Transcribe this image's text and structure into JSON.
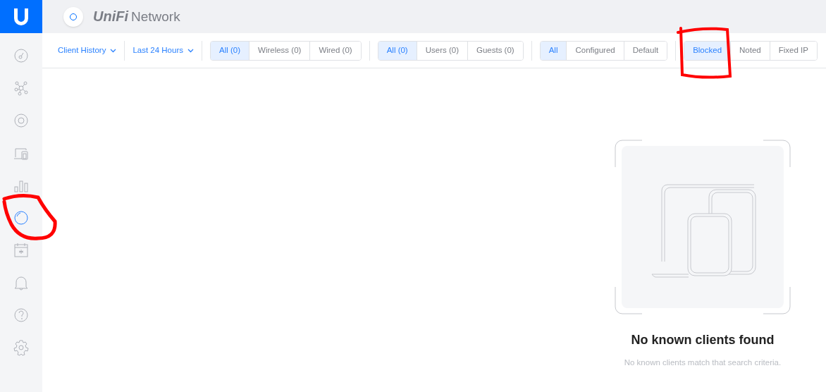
{
  "header": {
    "brand": "UniFi",
    "product": "Network"
  },
  "sidebar": {
    "items": [
      {
        "kind": "dashboard",
        "selected": false
      },
      {
        "kind": "topology",
        "selected": false
      },
      {
        "kind": "devices",
        "selected": false
      },
      {
        "kind": "clients",
        "selected": false
      },
      {
        "kind": "statistics",
        "selected": false
      },
      {
        "kind": "insights",
        "selected": true
      },
      {
        "kind": "events",
        "selected": false
      },
      {
        "kind": "alerts",
        "selected": false
      },
      {
        "kind": "help",
        "selected": false
      },
      {
        "kind": "settings",
        "selected": false
      }
    ]
  },
  "filters": {
    "dropdowns": [
      {
        "label": "Client History"
      },
      {
        "label": "Last 24 Hours"
      }
    ],
    "groups": [
      [
        {
          "label": "All (0)",
          "selected": true
        },
        {
          "label": "Wireless (0)",
          "selected": false
        },
        {
          "label": "Wired (0)",
          "selected": false
        }
      ],
      [
        {
          "label": "All (0)",
          "selected": true
        },
        {
          "label": "Users (0)",
          "selected": false
        },
        {
          "label": "Guests (0)",
          "selected": false
        }
      ],
      [
        {
          "label": "All",
          "selected": true
        },
        {
          "label": "Configured",
          "selected": false
        },
        {
          "label": "Default",
          "selected": false
        }
      ],
      [
        {
          "label": "Blocked",
          "selected": true
        },
        {
          "label": "Noted",
          "selected": false
        },
        {
          "label": "Fixed IP",
          "selected": false
        }
      ]
    ]
  },
  "empty_state": {
    "title": "No known clients found",
    "message": "No known clients match that search criteria."
  }
}
